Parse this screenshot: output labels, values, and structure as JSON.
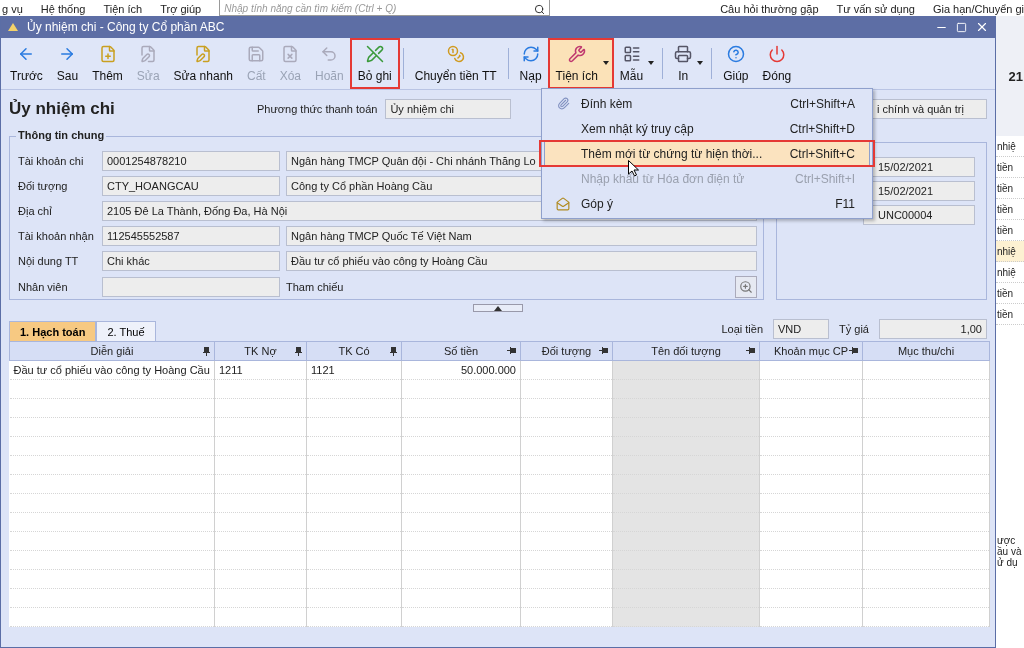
{
  "app_menu": [
    "g vụ",
    "Hệ thống",
    "Tiện ích",
    "Trợ giúp"
  ],
  "app_search": {
    "placeholder": "Nhập tính năng cần tìm kiếm (Ctrl + Q)"
  },
  "app_links": [
    "Câu hỏi thường gặp",
    "Tư vấn sử dụng",
    "Gia hạn/Chuyển gi"
  ],
  "window": {
    "title": "Ủy nhiệm chi - Công ty Cổ phần ABC"
  },
  "toolbar_groups": [
    [
      {
        "label": "Trước",
        "disabled": false,
        "highlighted": false,
        "pressed": false,
        "dropdown": false
      },
      {
        "label": "Sau",
        "disabled": false,
        "highlighted": false,
        "pressed": false,
        "dropdown": false
      },
      {
        "label": "Thêm",
        "disabled": false,
        "highlighted": false,
        "pressed": false,
        "dropdown": false
      },
      {
        "label": "Sửa",
        "disabled": true,
        "highlighted": false,
        "pressed": false,
        "dropdown": false
      },
      {
        "label": "Sửa nhanh",
        "disabled": false,
        "highlighted": false,
        "pressed": false,
        "dropdown": false
      },
      {
        "label": "Cất",
        "disabled": true,
        "highlighted": false,
        "pressed": false,
        "dropdown": false
      },
      {
        "label": "Xóa",
        "disabled": true,
        "highlighted": false,
        "pressed": false,
        "dropdown": false
      },
      {
        "label": "Hoãn",
        "disabled": true,
        "highlighted": false,
        "pressed": false,
        "dropdown": false
      },
      {
        "label": "Bỏ ghi",
        "disabled": false,
        "highlighted": true,
        "pressed": false,
        "dropdown": false
      }
    ],
    [
      {
        "label": "Chuyển tiền TT",
        "disabled": false,
        "highlighted": false,
        "pressed": false,
        "dropdown": false
      }
    ],
    [
      {
        "label": "Nạp",
        "disabled": false,
        "highlighted": false,
        "pressed": false,
        "dropdown": false
      },
      {
        "label": "Tiện ích",
        "disabled": false,
        "highlighted": true,
        "pressed": true,
        "dropdown": true
      },
      {
        "label": "Mẫu",
        "disabled": false,
        "highlighted": false,
        "pressed": false,
        "dropdown": true
      }
    ],
    [
      {
        "label": "In",
        "disabled": false,
        "highlighted": false,
        "pressed": false,
        "dropdown": true
      }
    ],
    [
      {
        "label": "Giúp",
        "disabled": false,
        "highlighted": false,
        "pressed": false,
        "dropdown": false
      },
      {
        "label": "Đóng",
        "disabled": false,
        "highlighted": false,
        "pressed": false,
        "dropdown": false
      }
    ]
  ],
  "form": {
    "heading": "Ủy nhiệm chi",
    "payment_method_label": "Phương thức thanh toán",
    "payment_method": "Ủy nhiệm chi",
    "side_field": "i chính và quản trị"
  },
  "general_info": {
    "title": "Thông tin chung",
    "rows": [
      {
        "kind": "pair",
        "label": "Tài khoản chi",
        "value": "0001254878210",
        "detail": "Ngân hàng TMCP Quân đội  - Chi nhánh Thăng Lo"
      },
      {
        "kind": "pair",
        "label": "Đối tượng",
        "value": "CTY_HOANGCAU",
        "detail": "Công ty Cổ phần Hoàng Cầu"
      },
      {
        "kind": "wide",
        "label": "Địa chỉ",
        "value": "2105 Đê La Thành, Đống Đa, Hà Nội"
      },
      {
        "kind": "pair",
        "label": "Tài khoản nhận",
        "value": "112545552587",
        "detail": "Ngân hàng TMCP Quốc Tế Việt Nam"
      },
      {
        "kind": "pair",
        "label": "Nội dung TT",
        "value": "Chi khác",
        "detail": "Đầu tư cổ phiếu vào công ty Hoàng Cầu"
      },
      {
        "kind": "reference",
        "label": "Nhân viên",
        "detail_label": "Tham chiếu"
      }
    ]
  },
  "voucher_fields": [
    "15/02/2021",
    "15/02/2021",
    "UNC00004"
  ],
  "tabs": [
    {
      "label": "1. Hạch toán",
      "selected": true
    },
    {
      "label": "2. Thuế",
      "selected": false
    }
  ],
  "currency": {
    "label": "Loại tiền",
    "value": "VND"
  },
  "rate": {
    "label": "Tỷ giá",
    "value": "1,00"
  },
  "table": {
    "columns": [
      {
        "label": "Diễn giải",
        "kind": "pinned",
        "shaded": false
      },
      {
        "label": "TK Nợ",
        "kind": "pinned",
        "shaded": false
      },
      {
        "label": "TK Có",
        "kind": "pinned",
        "shaded": false
      },
      {
        "label": "Số tiền",
        "kind": "docked",
        "numeric": true,
        "shaded": false
      },
      {
        "label": "Đối tượng",
        "kind": "docked",
        "shaded": false
      },
      {
        "label": "Tên đối tượng",
        "kind": "docked",
        "shaded": true
      },
      {
        "label": "Khoản mục CP",
        "kind": "docked",
        "shaded": false
      },
      {
        "label": "Mục thu/chi",
        "kind": "plain",
        "shaded": false
      }
    ],
    "rows": [
      [
        "Đầu tư cổ phiếu vào công ty Hoàng Cầu",
        "1211",
        "1121",
        "50.000.000"
      ]
    ]
  },
  "menu": {
    "items": [
      {
        "label": "Đính kèm",
        "shortcut": "Ctrl+Shift+A",
        "selected": false,
        "disabled": false,
        "highlighted": false
      },
      {
        "label": "Xem nhật ký truy cập",
        "shortcut": "Ctrl+Shift+D",
        "selected": false,
        "disabled": false,
        "highlighted": false
      },
      {
        "label": "Thêm mới từ chứng từ hiện thời...",
        "shortcut": "Ctrl+Shift+C",
        "selected": true,
        "disabled": false,
        "highlighted": true
      },
      {
        "label": "Nhập khẩu từ Hóa đơn điện tử",
        "shortcut": "Ctrl+Shift+I",
        "selected": false,
        "disabled": true,
        "highlighted": false
      },
      {
        "label": "Góp ý",
        "shortcut": "F11",
        "selected": false,
        "disabled": false,
        "highlighted": false
      }
    ]
  },
  "background_panel": {
    "heading": "21",
    "items": [
      {
        "label": "nhiệ",
        "selected": false
      },
      {
        "label": "tiền",
        "selected": false
      },
      {
        "label": "tiền",
        "selected": false
      },
      {
        "label": "tiền",
        "selected": false
      },
      {
        "label": "tiền",
        "selected": false
      },
      {
        "label": "nhiệ",
        "selected": true
      },
      {
        "label": "nhiệ",
        "selected": false
      },
      {
        "label": "tiền",
        "selected": false
      },
      {
        "label": "tiền",
        "selected": false
      }
    ],
    "notes": [
      "ược",
      "ầu và",
      "ử dụ"
    ]
  }
}
